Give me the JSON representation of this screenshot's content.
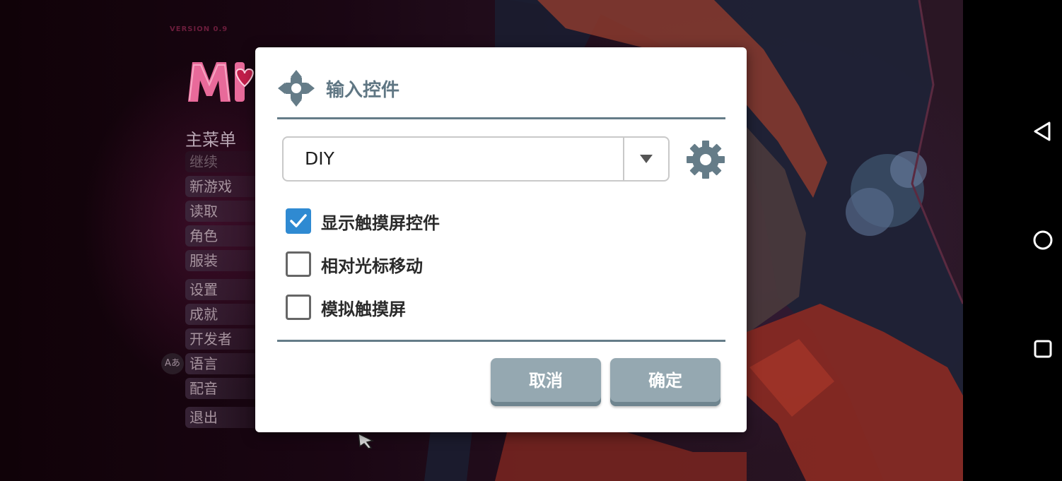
{
  "game": {
    "version_label": "VERSION 0.9",
    "menu_title": "主菜单",
    "menu_items": [
      {
        "label": "继续"
      },
      {
        "label": "新游戏"
      },
      {
        "label": "读取"
      },
      {
        "label": "角色"
      },
      {
        "label": "服装"
      },
      {
        "label": "设置"
      },
      {
        "label": "成就"
      },
      {
        "label": "开发者"
      },
      {
        "label": "语言"
      },
      {
        "label": "配音"
      },
      {
        "label": "退出"
      }
    ],
    "lang_badge": "Aあ"
  },
  "dialog": {
    "title": "输入控件",
    "icon": "dpad-icon",
    "layout_select": {
      "value": "DIY"
    },
    "settings_icon": "gear-icon",
    "options": [
      {
        "label": "显示触摸屏控件",
        "checked": true
      },
      {
        "label": "相对光标移动",
        "checked": false
      },
      {
        "label": "模拟触摸屏",
        "checked": false
      }
    ],
    "buttons": {
      "cancel": "取消",
      "ok": "确定"
    }
  },
  "nav_bar": {
    "back": "back-icon",
    "home": "home-icon",
    "recents": "recents-icon"
  },
  "colors": {
    "accent": "#2f8ad2",
    "title": "#5f7683",
    "divider": "#657c88",
    "button": "#95a8b1"
  }
}
